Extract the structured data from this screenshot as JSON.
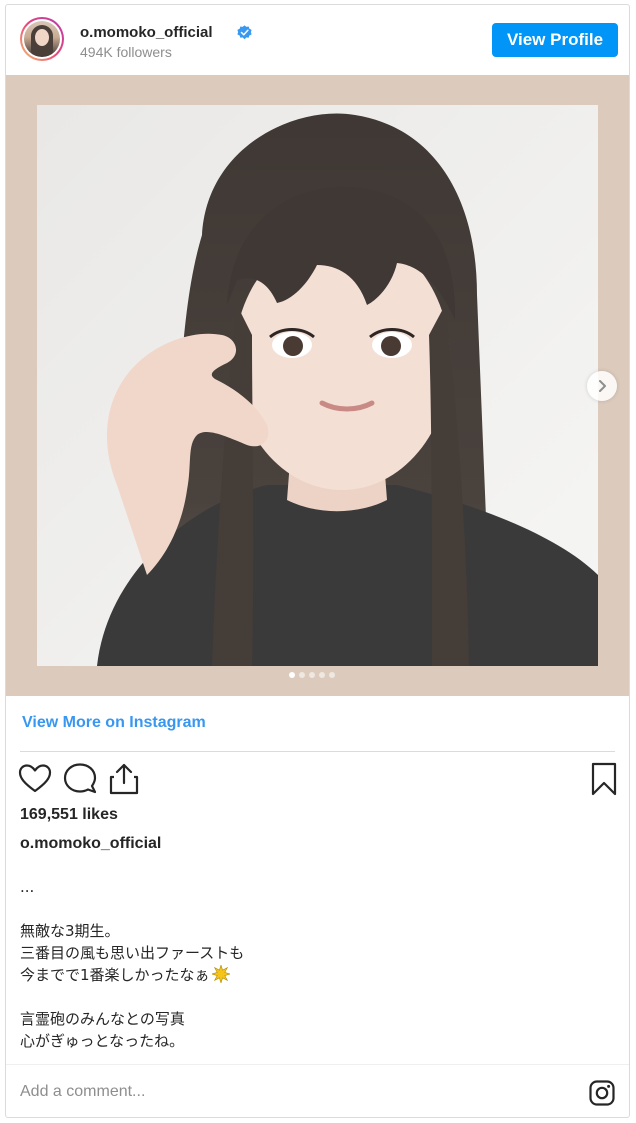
{
  "header": {
    "username": "o.momoko_official",
    "followers": "494K followers",
    "view_profile_label": "View Profile",
    "verified_icon": "verified-badge-icon"
  },
  "media": {
    "slide_count": 5,
    "active_slide": 1,
    "next_icon": "chevron-right-icon"
  },
  "view_more_label": "View More on Instagram",
  "actions": {
    "icons": [
      "heart-icon",
      "comment-icon",
      "share-icon",
      "bookmark-icon"
    ]
  },
  "likes": "169,551 likes",
  "caption": {
    "username": "o.momoko_official",
    "lines": [
      "...",
      "",
      "無敵な3期生。",
      "三番目の風も思い出ファーストも",
      "今までで1番楽しかったなぁ",
      "",
      "言霊砲のみんなとの写真",
      "心がぎゅっとなったね。"
    ],
    "emoji": "sparkle-icon"
  },
  "comment": {
    "placeholder": "Add a comment..."
  },
  "colors": {
    "accent": "#0095f6",
    "link": "#3897f0",
    "media_background": "#dccbbd"
  }
}
